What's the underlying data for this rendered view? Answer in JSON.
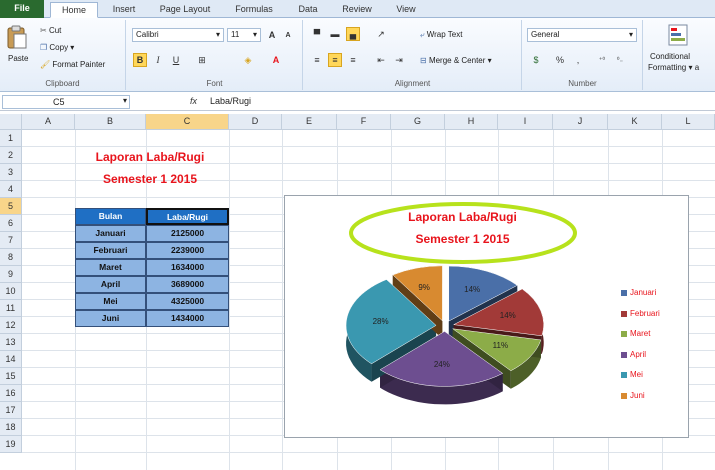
{
  "ribbon_tabs": [
    "File",
    "Home",
    "Insert",
    "Page Layout",
    "Formulas",
    "Data",
    "Review",
    "View"
  ],
  "clipboard": {
    "paste": "Paste",
    "cut": "Cut",
    "copy": "Copy ▾",
    "format_painter": "Format Painter",
    "label": "Clipboard"
  },
  "font": {
    "name": "Calibri",
    "size": "11",
    "label": "Font",
    "grow": "A",
    "shrink": "A",
    "bold": "B",
    "italic": "I",
    "underline": "U"
  },
  "alignment": {
    "wrap_text": "Wrap Text",
    "merge_center": "Merge & Center ▾",
    "label": "Alignment"
  },
  "number": {
    "format": "General",
    "percent": "%",
    "comma": ",",
    "label": "Number"
  },
  "styles": {
    "conditional_formatting": "Conditional",
    "conditional_formatting_line2": "Formatting ▾ a"
  },
  "formula_bar": {
    "name_box": "C5",
    "fx": "fx",
    "content": "Laba/Rugi"
  },
  "columns": [
    "A",
    "B",
    "C",
    "D",
    "E",
    "F",
    "G",
    "H",
    "I",
    "J",
    "K",
    "L"
  ],
  "rows": [
    "1",
    "2",
    "3",
    "4",
    "5",
    "6",
    "7",
    "8",
    "9",
    "10",
    "11",
    "12",
    "13",
    "14",
    "15",
    "16",
    "17",
    "18",
    "19"
  ],
  "sheet_title": {
    "line1": "Laporan Laba/Rugi",
    "line2": "Semester 1 2015"
  },
  "table": {
    "headers": [
      "Bulan",
      "Laba/Rugi"
    ],
    "rows": [
      [
        "Januari",
        "2125000"
      ],
      [
        "Februari",
        "2239000"
      ],
      [
        "Maret",
        "1634000"
      ],
      [
        "April",
        "3689000"
      ],
      [
        "Mei",
        "4325000"
      ],
      [
        "Juni",
        "1434000"
      ]
    ]
  },
  "chart_data": {
    "type": "pie",
    "title": "Laporan Laba/Rugi",
    "subtitle": "Semester 1 2015",
    "categories": [
      "Januari",
      "Februari",
      "Maret",
      "April",
      "Mei",
      "Juni"
    ],
    "values": [
      2125000,
      2239000,
      1634000,
      3689000,
      4325000,
      1434000
    ],
    "data_labels": [
      "14%",
      "14%",
      "11%",
      "24%",
      "28%",
      "9%"
    ],
    "colors": [
      "#4a6fa8",
      "#a23a38",
      "#8cac48",
      "#6d4e90",
      "#3a98b0",
      "#d88a30"
    ],
    "legend_position": "right",
    "style": "3d-exploded"
  }
}
